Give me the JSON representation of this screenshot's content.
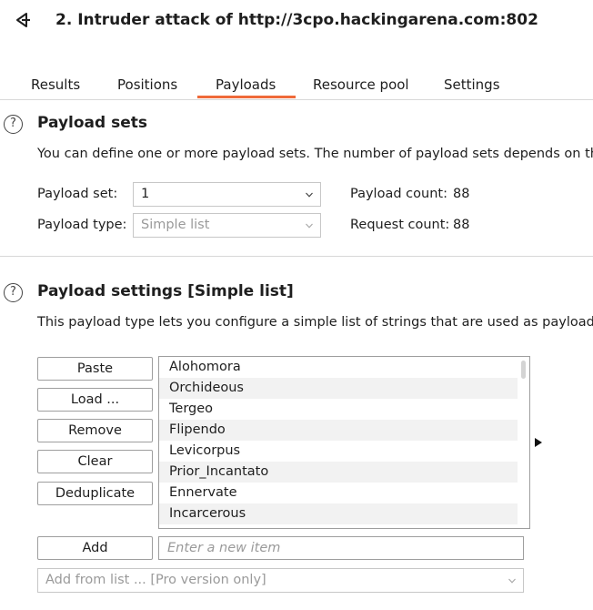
{
  "window": {
    "title": "2. Intruder attack of http://3cpo.hackingarena.com:802",
    "icon": "intruder-icon"
  },
  "tabs": [
    {
      "label": "Results"
    },
    {
      "label": "Positions"
    },
    {
      "label": "Payloads",
      "active": true
    },
    {
      "label": "Resource pool"
    },
    {
      "label": "Settings"
    }
  ],
  "payload_sets": {
    "help": "?",
    "title": "Payload sets",
    "description": "You can define one or more payload sets. The number of payload sets depends on th",
    "payload_set_label": "Payload set:",
    "payload_set_value": "1",
    "payload_type_label": "Payload type:",
    "payload_type_value": "Simple list",
    "payload_count_label": "Payload count:",
    "payload_count_value": "88",
    "request_count_label": "Request count:",
    "request_count_value": "88"
  },
  "payload_settings": {
    "help": "?",
    "title": "Payload settings [Simple list]",
    "description": "This payload type lets you configure a simple list of strings that are used as payloads",
    "buttons": {
      "paste": "Paste",
      "load": "Load ...",
      "remove": "Remove",
      "clear": "Clear",
      "deduplicate": "Deduplicate",
      "add": "Add"
    },
    "items": [
      "Alohomora",
      "Orchideous",
      "Tergeo",
      "Flipendo",
      "Levicorpus",
      "Prior_Incantato",
      "Ennervate",
      "Incarcerous"
    ],
    "add_placeholder": "Enter a new item",
    "add_from_list": "Add from list ... [Pro version only]"
  },
  "colors": {
    "accent": "#ef6a3a"
  }
}
